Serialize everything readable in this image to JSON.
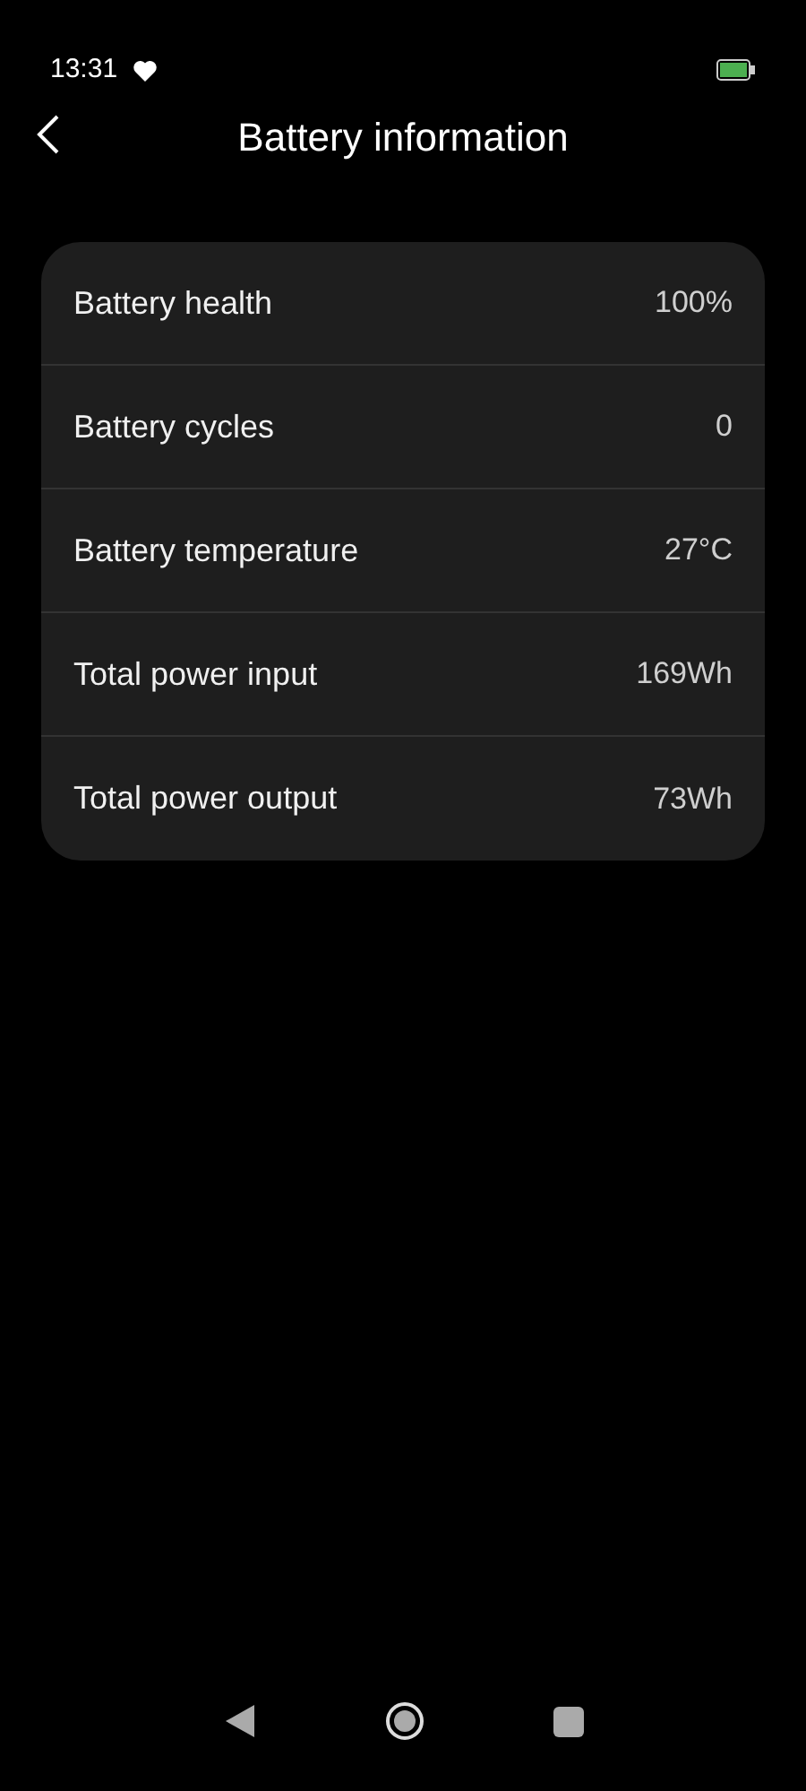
{
  "status_bar": {
    "time": "13:31"
  },
  "header": {
    "title": "Battery information"
  },
  "rows": [
    {
      "label": "Battery health",
      "value": "100%"
    },
    {
      "label": "Battery cycles",
      "value": "0"
    },
    {
      "label": "Battery temperature",
      "value": "27°C"
    },
    {
      "label": "Total power input",
      "value": "169Wh"
    },
    {
      "label": "Total power output",
      "value": "73Wh"
    }
  ]
}
